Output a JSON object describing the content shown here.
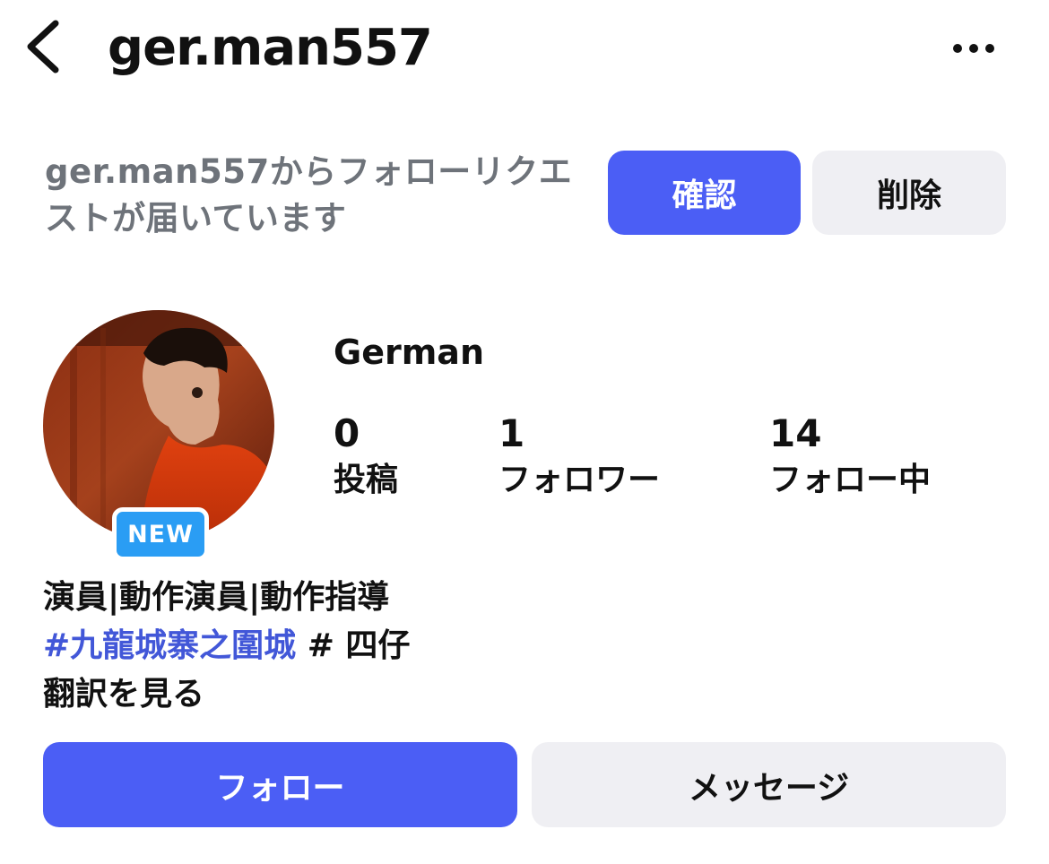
{
  "header": {
    "username": "ger.man557",
    "back_icon": "chevron-left-icon",
    "more_icon": "more-horizontal-icon"
  },
  "follow_request": {
    "message": "ger.man557からフォローリクエストが届いています",
    "confirm_label": "確認",
    "delete_label": "削除"
  },
  "profile": {
    "display_name": "German",
    "new_badge": "NEW",
    "stats": [
      {
        "value": "0",
        "label": "投稿"
      },
      {
        "value": "1",
        "label": "フォロワー"
      },
      {
        "value": "14",
        "label": "フォロー中"
      }
    ]
  },
  "bio": {
    "line1": "演員|動作演員|動作指導",
    "hashtag": "#九龍城寨之圍城",
    "line2_rest": " # 四仔",
    "translate_label": "翻訳を見る"
  },
  "actions": {
    "follow_label": "フォロー",
    "message_label": "メッセージ"
  },
  "colors": {
    "accent": "#4b5ef5",
    "secondary_button": "#efeff3",
    "link": "#4257d8",
    "badge": "#2a9df4",
    "muted_text": "#6e737a"
  }
}
